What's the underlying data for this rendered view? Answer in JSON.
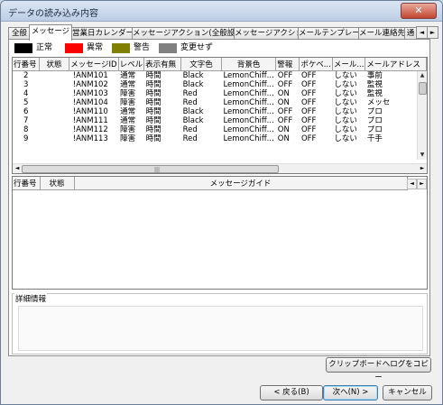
{
  "window": {
    "title": "データの読み込み内容",
    "close_glyph": "✕"
  },
  "tabs": [
    {
      "label": "全般"
    },
    {
      "label": "メッセージ"
    },
    {
      "label": "営業日カレンダー"
    },
    {
      "label": "メッセージアクション(全般設定)"
    },
    {
      "label": "メッセージアクション"
    },
    {
      "label": "メールテンプレート"
    },
    {
      "label": "メール連絡先"
    },
    {
      "label": "通"
    }
  ],
  "tab_scroll": {
    "left": "◄",
    "right": "►"
  },
  "legend": [
    {
      "label": "正常",
      "color": "#000000"
    },
    {
      "label": "異常",
      "color": "#ff0000"
    },
    {
      "label": "警告",
      "color": "#808000"
    },
    {
      "label": "変更せず",
      "color": "#808080"
    }
  ],
  "message_grid": {
    "columns": [
      "行番号",
      "状態",
      "メッセージID",
      "レベル",
      "表示有無",
      "文字色",
      "背景色",
      "警報",
      "ポケベ...",
      "メール...",
      "メールアドレス"
    ],
    "rows": [
      [
        "2",
        "",
        "!ANM101",
        "通常",
        "時間",
        "Black",
        "LemonChiff...",
        "OFF",
        "OFF",
        "しない",
        "事前"
      ],
      [
        "3",
        "",
        "!ANM102",
        "通常",
        "時間",
        "Black",
        "LemonChiff...",
        "OFF",
        "OFF",
        "しない",
        "監視"
      ],
      [
        "4",
        "",
        "!ANM103",
        "障害",
        "時間",
        "Red",
        "LemonChiff...",
        "ON",
        "OFF",
        "しない",
        "監視"
      ],
      [
        "5",
        "",
        "!ANM104",
        "障害",
        "時間",
        "Red",
        "LemonChiff...",
        "ON",
        "OFF",
        "しない",
        "メッセ"
      ],
      [
        "6",
        "",
        "!ANM110",
        "通常",
        "時間",
        "Black",
        "LemonChiff...",
        "OFF",
        "OFF",
        "しない",
        "プロ"
      ],
      [
        "7",
        "",
        "!ANM111",
        "通常",
        "時間",
        "Black",
        "LemonChiff...",
        "OFF",
        "OFF",
        "しない",
        "プロ"
      ],
      [
        "8",
        "",
        "!ANM112",
        "障害",
        "時間",
        "Red",
        "LemonChiff...",
        "ON",
        "OFF",
        "しない",
        "プロ"
      ],
      [
        "9",
        "",
        "!ANM113",
        "障害",
        "時間",
        "Red",
        "LemonChiff...",
        "ON",
        "OFF",
        "しない",
        "千手"
      ]
    ],
    "scroll": {
      "up": "▲",
      "down": "▼",
      "left": "◄",
      "right": "►",
      "grip": "|||"
    }
  },
  "guide_grid": {
    "columns": [
      "行番号",
      "状態",
      "メッセージガイド"
    ],
    "scroll": {
      "left": "◄",
      "right": "►"
    }
  },
  "detail": {
    "label": "詳細情報"
  },
  "buttons": {
    "clipboard": "クリップボードへログをコピー",
    "back": "< 戻る(B)",
    "next": "次へ(N) >",
    "cancel": "キャンセル"
  }
}
